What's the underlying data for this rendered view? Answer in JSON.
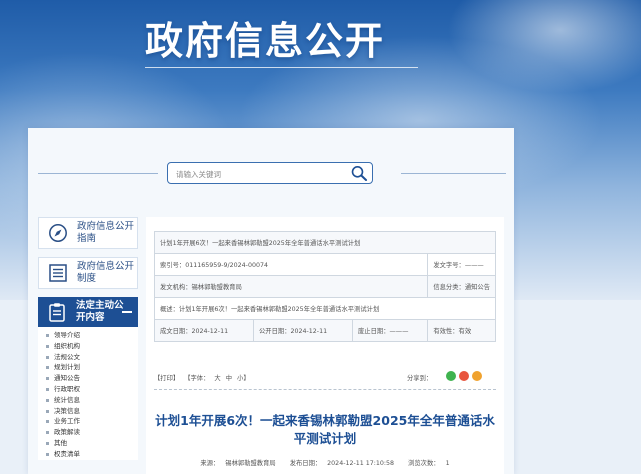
{
  "hero": {
    "title": "政府信息公开"
  },
  "search": {
    "placeholder": "请输入关键词"
  },
  "sidebar": {
    "cards": [
      {
        "label": "政府信息公开指南",
        "icon": "compass-icon"
      },
      {
        "label": "政府信息公开制度",
        "icon": "document-list-icon"
      }
    ],
    "active": {
      "label": "法定主动公开内容",
      "icon": "clipboard-icon",
      "toggle": "−"
    },
    "sub_items": [
      "领导介绍",
      "组织机构",
      "法规公文",
      "规划计划",
      "通知公告",
      "行政职权",
      "统计信息",
      "决策信息",
      "业务工作",
      "政策解读",
      "其他",
      "权责清单"
    ]
  },
  "meta": {
    "index_title": "计划1年开展6次！一起来香锡林郭勒盟2025年全年普通话水平测试计划",
    "index_no_label": "索引号：",
    "index_no": "011165959-9/2024-00074",
    "doc_no_label": "发文字号：",
    "doc_no": "———",
    "issuer_label": "发文机构：",
    "issuer": "锡林郭勒盟教育局",
    "category_label": "信息分类：",
    "category": "通知公告",
    "summary_label": "概述：",
    "summary": "计划1年开展6次！一起来香锡林郭勒盟2025年全年普通话水平测试计划",
    "created_label": "成文日期：",
    "created": "2024-12-11",
    "published_label": "公开日期：",
    "published": "2024-12-11",
    "abolished_label": "废止日期：",
    "abolished": "———",
    "validity_label": "有效性：",
    "validity": "有效"
  },
  "toolbar": {
    "print": "【打印】",
    "font_label": "【字体：",
    "font_large": "大",
    "font_medium": "中",
    "font_small": "小】",
    "share_label": "分享到："
  },
  "article": {
    "title": "计划1年开展6次！一起来香锡林郭勒盟2025年全年普通话水平测试计划",
    "source_label": "来源：",
    "source": "锡林郭勒盟教育局",
    "date_label": "发布日期：",
    "date": "2024-12-11 17:10:58",
    "views_label": "浏览次数：",
    "views": "1"
  },
  "colors": {
    "primary": "#1d4f94",
    "share_wechat": "#3fb34f",
    "share_weibo": "#e8553e",
    "share_other": "#f0a22e"
  }
}
